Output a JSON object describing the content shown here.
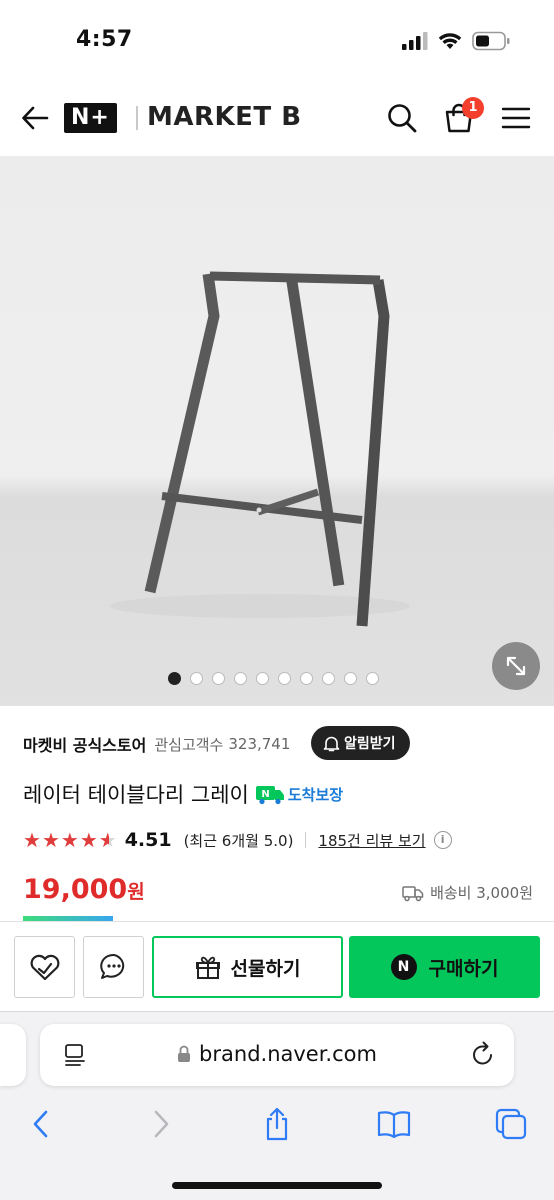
{
  "status_bar": {
    "time": "4:57"
  },
  "header": {
    "logo_mark": "N+",
    "logo_brand": "MARKET B",
    "cart_badge": "1"
  },
  "gallery": {
    "image_count": 10,
    "active_index": 0
  },
  "store": {
    "name": "마켓비 공식스토어",
    "follower_label": "관심고객수",
    "follower_count": "323,741",
    "notify_label": "알림받기"
  },
  "product": {
    "title": "레이터 테이블다리 그레이",
    "delivery_badge": "도착보장"
  },
  "rating": {
    "score": "4.51",
    "stars_fraction": 0.9,
    "recent": "(최근 6개월 5.0)",
    "review_link": "185건 리뷰 보기"
  },
  "price": {
    "amount": "19,000",
    "unit": "원",
    "shipping": "배송비 3,000원"
  },
  "actions": {
    "gift_label": "선물하기",
    "buy_label": "구매하기",
    "buy_icon_letter": "N"
  },
  "browser": {
    "url": "brand.naver.com"
  },
  "colors": {
    "price_red": "#e02b2b",
    "naver_green": "#03c75a",
    "badge_red": "#f33f2c",
    "delivery_blue": "#1a7cd6"
  }
}
